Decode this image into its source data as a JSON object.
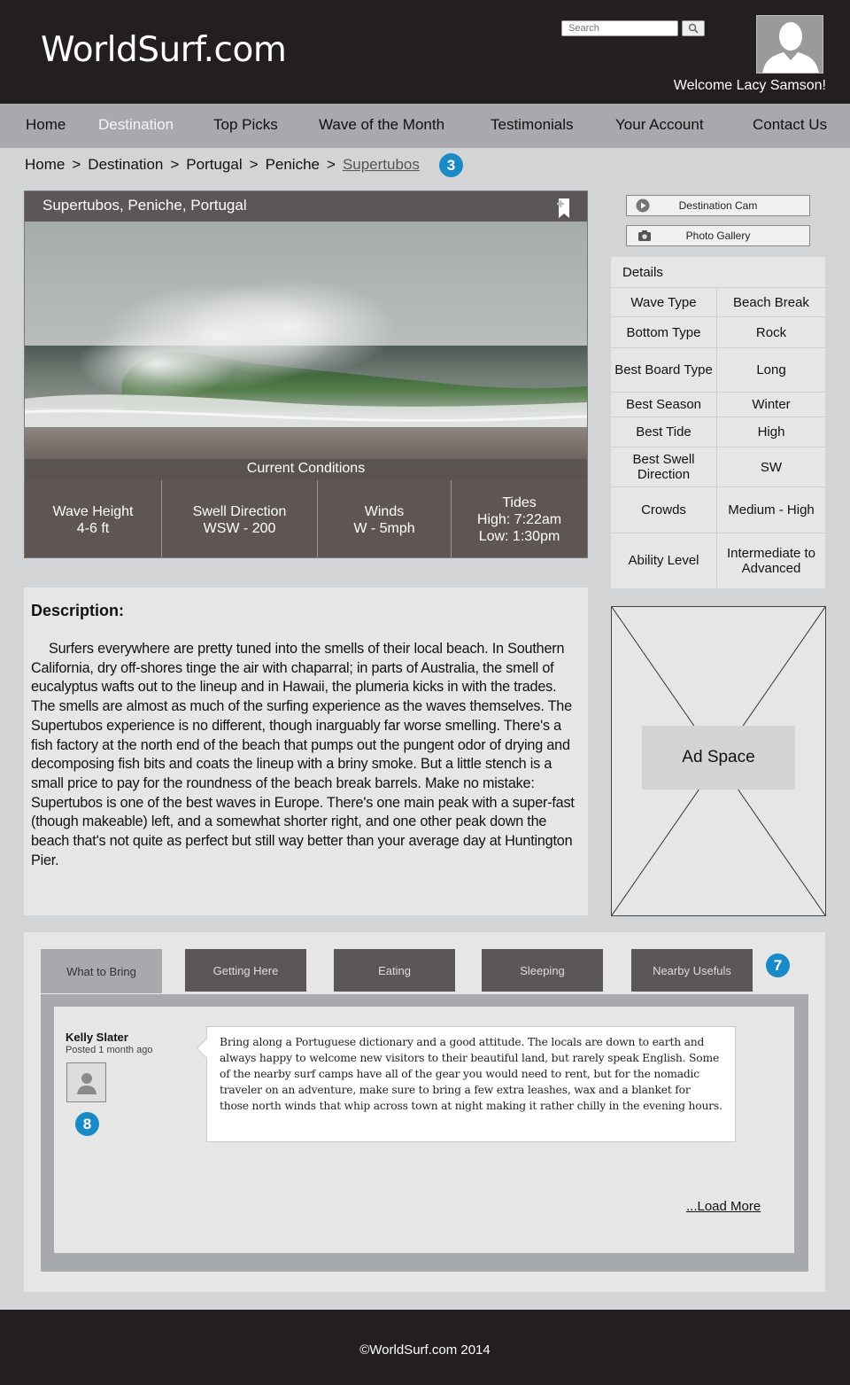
{
  "header": {
    "logo": "WorldSurf.com",
    "search_placeholder": "Search",
    "welcome": "Welcome Lacy Samson!"
  },
  "nav": {
    "items": [
      "Home",
      "Destination",
      "Top Picks",
      "Wave of the Month",
      "Testimonials",
      "Your Account",
      "Contact Us"
    ],
    "active": "Destination"
  },
  "breadcrumb": {
    "items": [
      "Home",
      "Destination",
      "Portugal",
      "Peniche",
      "Supertubos"
    ],
    "separator": ">",
    "badge": "3"
  },
  "hero": {
    "title": "Supertubos, Peniche, Portugal",
    "conditions_title": "Current Conditions",
    "conditions": [
      {
        "label": "Wave Height",
        "value": "4-6 ft"
      },
      {
        "label": "Swell Direction",
        "value": "WSW - 200"
      },
      {
        "label": "Winds",
        "value": "W - 5mph"
      },
      {
        "label": "Tides",
        "value": "High: 7:22am",
        "value2": "Low: 1:30pm"
      }
    ]
  },
  "side_buttons": {
    "cam": "Destination Cam",
    "gallery": "Photo Gallery"
  },
  "details": {
    "heading": "Details",
    "rows": [
      {
        "k": "Wave Type",
        "v": "Beach Break"
      },
      {
        "k": "Bottom Type",
        "v": "Rock"
      },
      {
        "k": "Best Board Type",
        "v": "Long"
      },
      {
        "k": "Best Season",
        "v": "Winter"
      },
      {
        "k": "Best Tide",
        "v": "High"
      },
      {
        "k": "Best Swell Direction",
        "v": "SW"
      },
      {
        "k": "Crowds",
        "v": "Medium - High"
      },
      {
        "k": "Ability Level",
        "v": "Intermediate to Advanced"
      }
    ]
  },
  "description": {
    "heading": "Description:",
    "text": "Surfers everywhere are pretty tuned into the smells of their local beach. In Southern California, dry off-shores tinge the air with chaparral; in parts of Australia, the smell of eucalyptus wafts out to the lineup and in Hawaii, the plumeria kicks in with the trades. The smells are almost as much of the surfing experience as the waves themselves. The Supertubos experience is no different, though inarguably far worse smelling. There's a fish factory at the north end of the beach that pumps out the pungent odor of drying and decomposing fish bits and coats the lineup with a briny smoke. But a little stench is a small price to pay for the roundness of the beach break barrels. Make no mistake: Supertubos is one of the best waves in Europe. There's one main peak with a super-fast (though makeable) left, and a somewhat shorter right, and one other peak down the beach that's not quite as perfect but still way better than your average day at Huntington Pier."
  },
  "ad": {
    "label": "Ad Space"
  },
  "tabs": {
    "items": [
      "What to Bring",
      "Getting Here",
      "Eating",
      "Sleeping",
      "Nearby Usefuls"
    ],
    "active": "What to Bring",
    "badge": "7"
  },
  "comment": {
    "author": "Kelly Slater",
    "posted": "Posted  1 month ago",
    "badge": "8",
    "text": "Bring along a Portuguese dictionary and a good attitude. The locals are down to earth and always happy to welcome new visitors to their beautiful land, but rarely speak English. Some of the nearby surf camps have all of the gear you would need to rent, but for the nomadic traveler on an adventure, make sure to bring a few extra leashes, wax and a blanket for those north winds that whip across town at night making it rather chilly in the evening hours.",
    "load_more": "...Load More"
  },
  "footer": {
    "copyright": "©WorldSurf.com 2014"
  }
}
